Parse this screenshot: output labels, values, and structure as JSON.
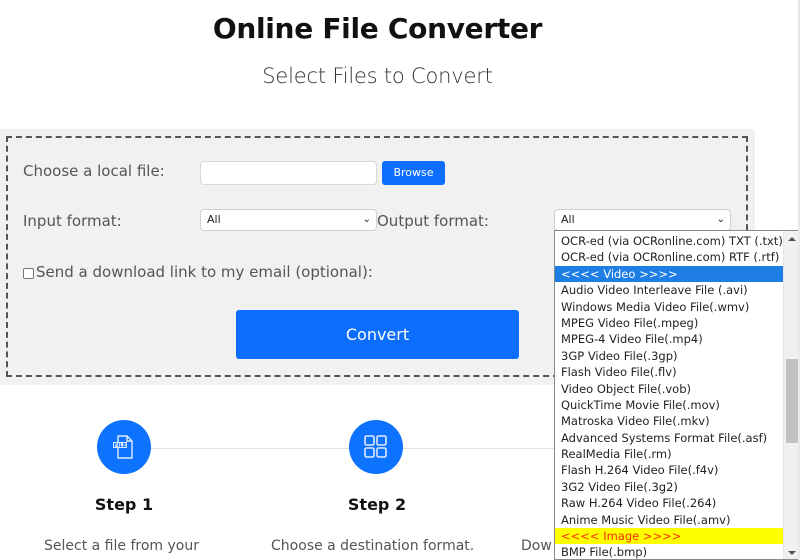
{
  "header": {
    "title": "Online File Converter",
    "subtitle": "Select Files to Convert"
  },
  "form": {
    "file_label": "Choose a local file:",
    "file_value": "",
    "browse_label": "Browse",
    "input_format_label": "Input format:",
    "input_format_value": "All",
    "output_format_label": "Output format:",
    "output_format_value": "All",
    "email_label": "Send a download link to my email (optional):",
    "email_checked": false,
    "convert_label": "Convert"
  },
  "output_dropdown": {
    "items": [
      {
        "label": "OCR-ed (via OCRonline.com) TXT (.txt)",
        "type": "option"
      },
      {
        "label": "OCR-ed (via OCRonline.com) RTF (.rtf)",
        "type": "option"
      },
      {
        "label": "<<<< Video >>>>",
        "type": "group-highlighted"
      },
      {
        "label": "Audio Video Interleave File (.avi)",
        "type": "option"
      },
      {
        "label": "Windows Media Video File(.wmv)",
        "type": "option"
      },
      {
        "label": "MPEG Video File(.mpeg)",
        "type": "option"
      },
      {
        "label": "MPEG-4 Video File(.mp4)",
        "type": "option"
      },
      {
        "label": "3GP Video File(.3gp)",
        "type": "option"
      },
      {
        "label": "Flash Video File(.flv)",
        "type": "option"
      },
      {
        "label": "Video Object File(.vob)",
        "type": "option"
      },
      {
        "label": "QuickTime Movie File(.mov)",
        "type": "option"
      },
      {
        "label": "Matroska Video File(.mkv)",
        "type": "option"
      },
      {
        "label": "Advanced Systems Format File(.asf)",
        "type": "option"
      },
      {
        "label": "RealMedia File(.rm)",
        "type": "option"
      },
      {
        "label": "Flash H.264 Video File(.f4v)",
        "type": "option"
      },
      {
        "label": "3G2 Video File(.3g2)",
        "type": "option"
      },
      {
        "label": "Raw H.264 Video File(.264)",
        "type": "option"
      },
      {
        "label": "Anime Music Video File(.amv)",
        "type": "option"
      },
      {
        "label": "<<<< Image >>>>",
        "type": "group-image"
      },
      {
        "label": "BMP File(.bmp)",
        "type": "option"
      }
    ],
    "colors": {
      "selected_bg": "#1e7ee6",
      "image_group_bg": "#ffff00",
      "image_group_text": "#ff2a00"
    }
  },
  "steps": [
    {
      "title": "Step 1",
      "description": "Select a file from your",
      "icon": "file-icon"
    },
    {
      "title": "Step 2",
      "description": "Choose a destination format.",
      "icon": "grid-icon"
    },
    {
      "title": "",
      "description": "Dow",
      "icon": ""
    }
  ],
  "colors": {
    "accent": "#0d6efd",
    "panel_bg": "#f1f1f1"
  }
}
